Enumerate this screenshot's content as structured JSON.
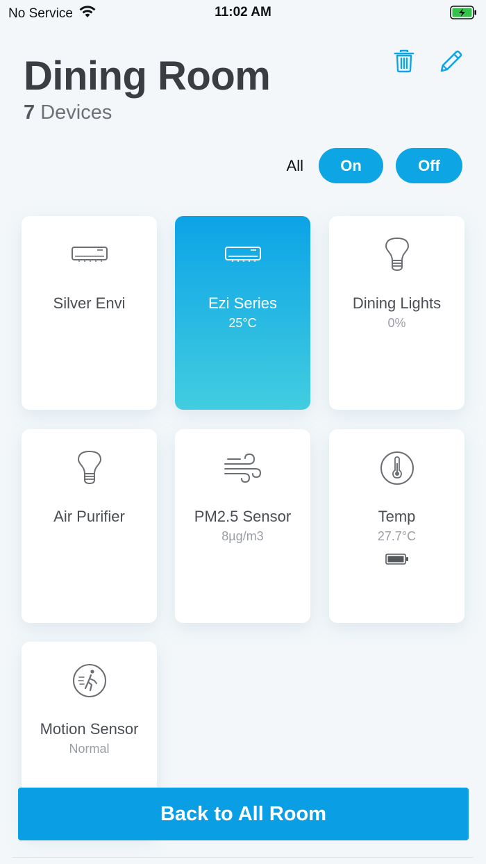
{
  "status_bar": {
    "carrier": "No Service",
    "time": "11:02 AM",
    "wifi_icon": "wifi-icon",
    "battery_icon": "battery-charging-icon"
  },
  "header": {
    "title": "Dining Room",
    "device_count": "7",
    "device_count_label": "Devices",
    "actions": [
      {
        "icon": "trash-icon"
      },
      {
        "icon": "pencil-icon"
      }
    ]
  },
  "filter": {
    "all_label": "All",
    "on_label": "On",
    "off_label": "Off"
  },
  "devices": [
    {
      "name": "Silver Envi",
      "value": "",
      "icon": "air-conditioner-icon",
      "active": false
    },
    {
      "name": "Ezi Series",
      "value": "25°C",
      "icon": "air-conditioner-icon",
      "active": true
    },
    {
      "name": "Dining Lights",
      "value": "0%",
      "icon": "light-bulb-icon",
      "active": false
    },
    {
      "name": "Air Purifier",
      "value": "",
      "icon": "light-bulb-icon",
      "active": false
    },
    {
      "name": "PM2.5 Sensor",
      "value": "8µg/m3",
      "icon": "wind-icon",
      "active": false
    },
    {
      "name": "Temp",
      "value": "27.7°C",
      "icon": "thermometer-icon",
      "active": false,
      "battery_icon": "battery-icon"
    },
    {
      "name": "Motion Sensor",
      "value": "Normal",
      "icon": "motion-sensor-icon",
      "active": false
    }
  ],
  "footer": {
    "back_label": "Back to All Room"
  },
  "colors": {
    "accent": "#0ea5e4",
    "tile_active_top": "#0ba3e6",
    "tile_active_bottom": "#42cde0",
    "background": "#f3f7f9"
  }
}
